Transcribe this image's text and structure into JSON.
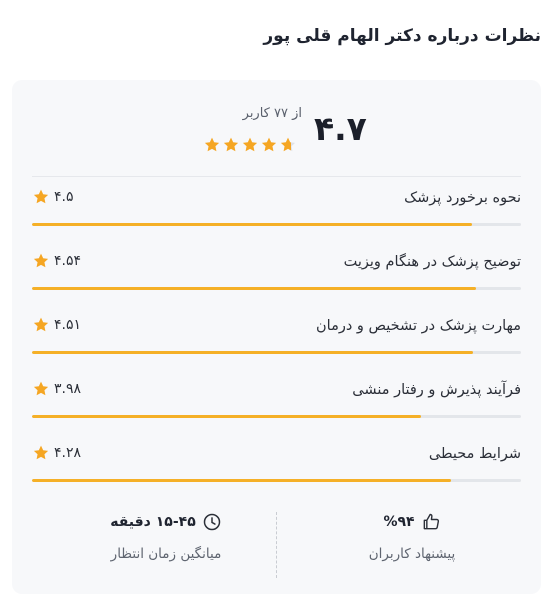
{
  "page": {
    "title": "نظرات درباره دکتر الهام قلی پور"
  },
  "summary": {
    "average": "۴.۷",
    "count_text": "از ۷۷ کاربر",
    "stars_value": 4.7
  },
  "ratings": [
    {
      "label": "نحوه برخورد پزشک",
      "score": "۴.۵",
      "value": 4.5
    },
    {
      "label": "توضیح پزشک در هنگام ویزیت",
      "score": "۴.۵۴",
      "value": 4.54
    },
    {
      "label": "مهارت پزشک در تشخیص و درمان",
      "score": "۴.۵۱",
      "value": 4.51
    },
    {
      "label": "فرآیند پذیرش و رفتار منشی",
      "score": "۳.۹۸",
      "value": 3.98
    },
    {
      "label": "شرایط محیطی",
      "score": "۴.۲۸",
      "value": 4.28
    }
  ],
  "stats": {
    "wait_time": "۱۵-۴۵ دقیقه",
    "wait_label": "میانگین زمان انتظار",
    "recommend": "%۹۴",
    "recommend_label": "پیشنهاد کاربران"
  },
  "icons": {
    "star": "star-icon",
    "clock": "clock-icon",
    "thumb": "thumbs-up-icon"
  },
  "colors": {
    "star": "#f5a623",
    "bar": "#f5b027",
    "track": "#e3e6ea"
  }
}
